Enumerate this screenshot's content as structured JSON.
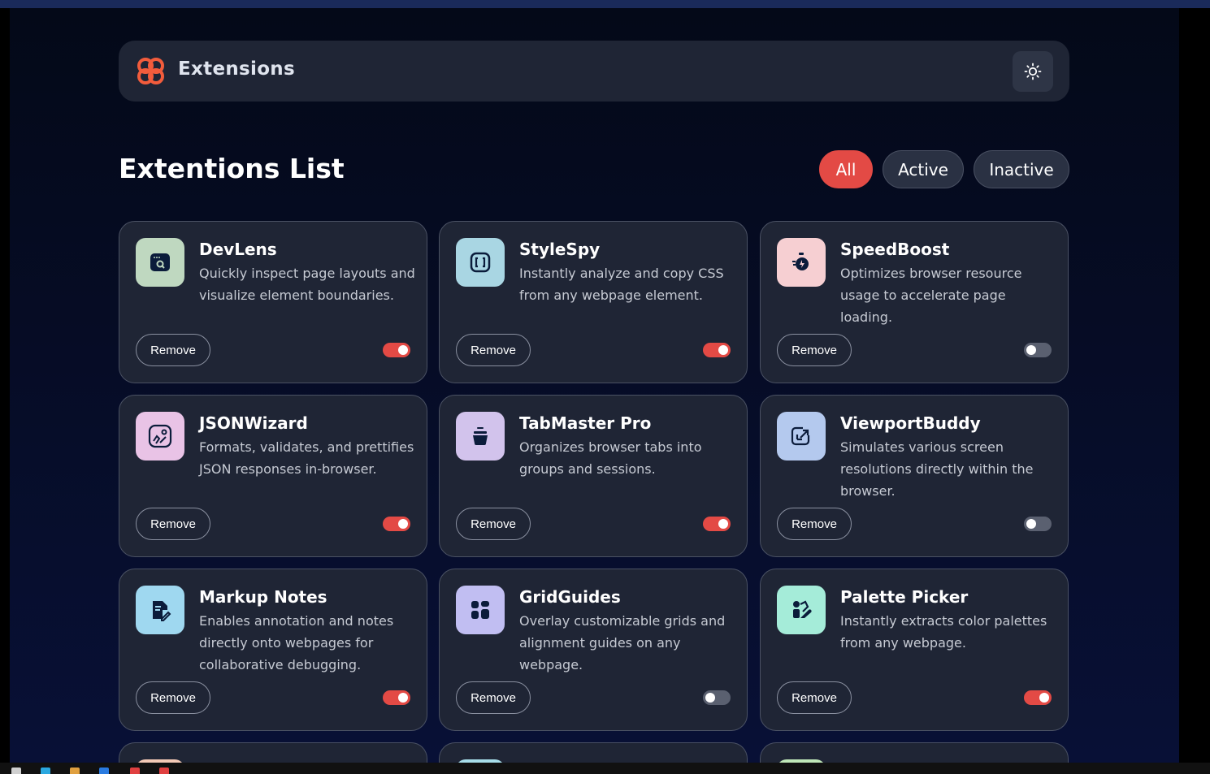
{
  "header": {
    "logo_text": "Extensions",
    "logo_icon": "logo-icon",
    "theme_toggle_icon": "sun-icon"
  },
  "main": {
    "title": "Extentions List",
    "filters": [
      {
        "label": "All",
        "selected": true
      },
      {
        "label": "Active",
        "selected": false
      },
      {
        "label": "Inactive",
        "selected": false
      }
    ]
  },
  "extensions": [
    {
      "name": "DevLens",
      "description": "Quickly inspect page layouts and visualize element boundaries.",
      "remove_label": "Remove",
      "active": true,
      "icon": "devlens-icon",
      "icon_bg": "#bfd8c0"
    },
    {
      "name": "StyleSpy",
      "description": "Instantly analyze and copy CSS from any webpage element.",
      "remove_label": "Remove",
      "active": true,
      "icon": "stylespy-icon",
      "icon_bg": "#a9d6e3"
    },
    {
      "name": "SpeedBoost",
      "description": "Optimizes browser resource usage to accelerate page loading.",
      "remove_label": "Remove",
      "active": false,
      "icon": "speedboost-icon",
      "icon_bg": "#f6cfd2"
    },
    {
      "name": "JSONWizard",
      "description": "Formats, validates, and prettifies JSON responses in-browser.",
      "remove_label": "Remove",
      "active": true,
      "icon": "jsonwizard-icon",
      "icon_bg": "#e9c3e6"
    },
    {
      "name": "TabMaster Pro",
      "description": "Organizes browser tabs into groups and sessions.",
      "remove_label": "Remove",
      "active": true,
      "icon": "tabmaster-icon",
      "icon_bg": "#d2c3ec"
    },
    {
      "name": "ViewportBuddy",
      "description": "Simulates various screen resolutions directly within the browser.",
      "remove_label": "Remove",
      "active": false,
      "icon": "viewportbuddy-icon",
      "icon_bg": "#b4c9ee"
    },
    {
      "name": "Markup Notes",
      "description": "Enables annotation and notes directly onto webpages for collaborative debugging.",
      "remove_label": "Remove",
      "active": true,
      "icon": "markupnotes-icon",
      "icon_bg": "#9fd8f0"
    },
    {
      "name": "GridGuides",
      "description": "Overlay customizable grids and alignment guides on any webpage.",
      "remove_label": "Remove",
      "active": false,
      "icon": "gridguides-icon",
      "icon_bg": "#c1bef2"
    },
    {
      "name": "Palette Picker",
      "description": "Instantly extracts color palettes from any webpage.",
      "remove_label": "Remove",
      "active": true,
      "icon": "palettepicker-icon",
      "icon_bg": "#a5ecd9"
    }
  ],
  "partial_cards": [
    {
      "icon_bg": "#f3c9b6"
    },
    {
      "icon_bg": "#a7dde9"
    },
    {
      "icon_bg": "#bfe7b8"
    }
  ],
  "colors": {
    "accent": "#e34a45",
    "card_bg": "#1f2535",
    "page_bg": "#040918"
  }
}
